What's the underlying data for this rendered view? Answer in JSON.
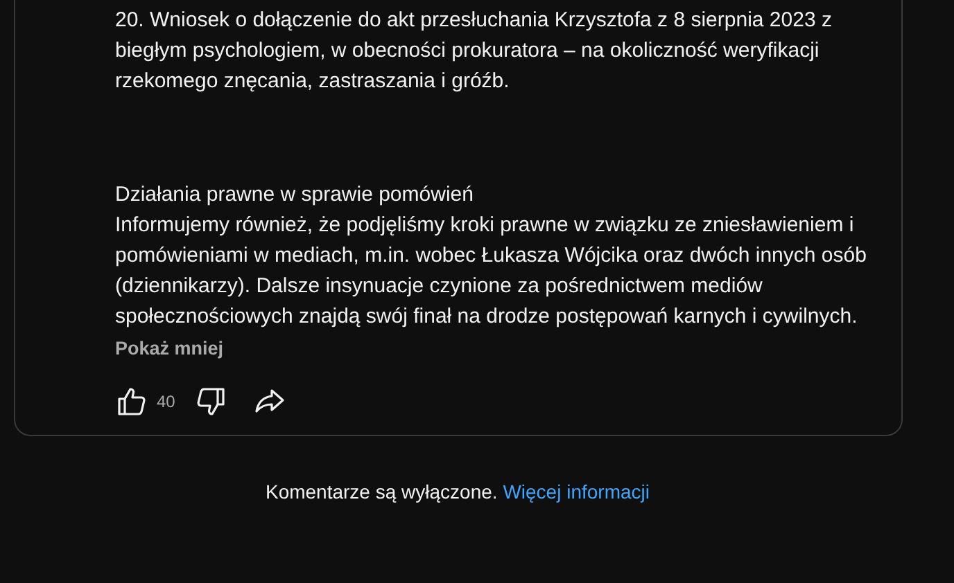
{
  "post": {
    "paragraphs": [
      {
        "kind": "text",
        "text": "20. Wniosek o dołączenie do akt przesłuchania Krzysztofa z 8 sierpnia 2023 z biegłym psychologiem, w obecności prokuratora – na okoliczność weryfikacji rzekomego znęcania, zastraszania i gróźb."
      },
      {
        "kind": "heading",
        "text": "Działania prawne w sprawie pomówień"
      },
      {
        "kind": "text",
        "text": "Informujemy również, że podjęliśmy kroki prawne w związku ze zniesławieniem i pomówieniami w mediach, m.in. wobec Łukasza Wójcika oraz dwóch innych osób (dziennikarzy). Dalsze insynuacje czynione za pośrednictwem mediów społecznościowych znajdą swój finał na drodze postępowań karnych i cywilnych."
      }
    ],
    "toggle": "Pokaż mniej",
    "likes": "40"
  },
  "footer": {
    "text": "Komentarze są wyłączone.",
    "link": "Więcej informacji"
  }
}
